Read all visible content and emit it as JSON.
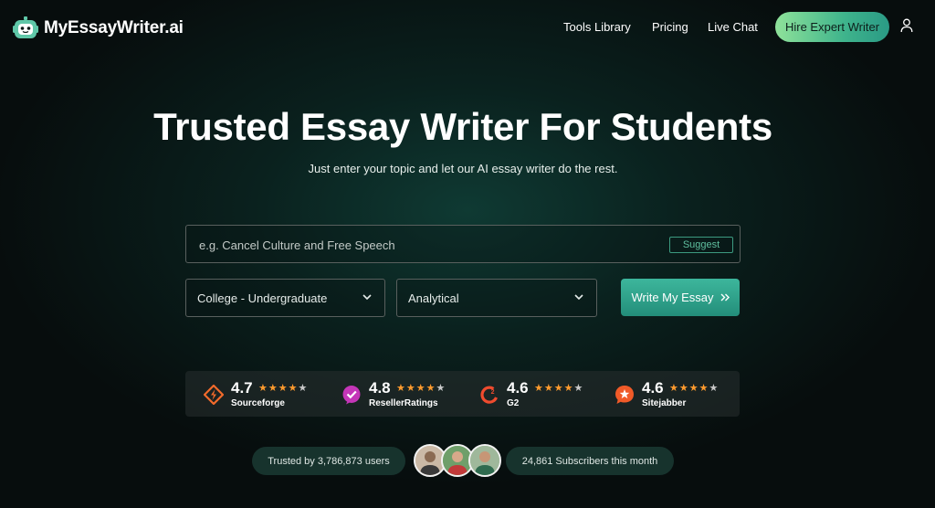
{
  "brand": {
    "name": "MyEssayWriter.ai",
    "logo_icon": "robot-face-icon",
    "accent": "#3db69c"
  },
  "nav": {
    "tools": "Tools Library",
    "pricing": "Pricing",
    "chat": "Live Chat",
    "hire": "Hire Expert Writer",
    "user_icon": "user-icon"
  },
  "hero": {
    "title": "Trusted Essay Writer For Students",
    "subtitle": "Just enter your topic and let our AI essay writer do the rest."
  },
  "form": {
    "topic_placeholder": "e.g. Cancel Culture and Free Speech",
    "topic_value": "",
    "suggest_label": "Suggest",
    "academic_level": "College - Undergraduate",
    "essay_type": "Analytical",
    "submit_label": "Write My Essay"
  },
  "ratings": [
    {
      "score": "4.7",
      "name": "Sourceforge",
      "stars": 4.7,
      "icon": "sourceforge-icon",
      "color": "#f26a2b"
    },
    {
      "score": "4.8",
      "name": "ResellerRatings",
      "stars": 4.8,
      "icon": "resellerratings-icon",
      "color": "#c436b8"
    },
    {
      "score": "4.6",
      "name": "G2",
      "stars": 4.6,
      "icon": "g2-icon",
      "color": "#ef4b2e"
    },
    {
      "score": "4.6",
      "name": "Sitejabber",
      "stars": 4.6,
      "icon": "sitejabber-icon",
      "color": "#f05a28"
    }
  ],
  "trust": {
    "users": "Trusted by 3,786,873 users",
    "subscribers": "24,861 Subscribers this month"
  }
}
